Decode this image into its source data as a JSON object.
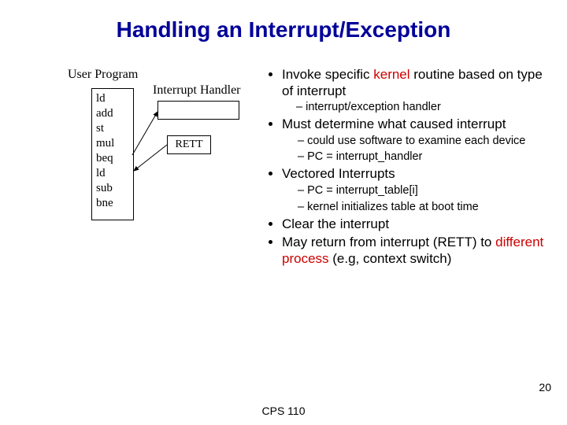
{
  "title": "Handling an Interrupt/Exception",
  "diagram": {
    "user_program_label": "User Program",
    "instructions": [
      "ld",
      "add",
      "st",
      "mul",
      "beq",
      "ld",
      "sub",
      "bne"
    ],
    "interrupt_handler_label": "Interrupt Handler",
    "rett_label": "RETT"
  },
  "bullets": {
    "b1_pre": "Invoke specific ",
    "b1_red": "kernel",
    "b1_post": " routine based on type of interrupt",
    "b1_sub1": "interrupt/exception handler",
    "b2": "Must determine what caused interrupt",
    "b2_sub1": "could use software to examine each device",
    "b2_sub2": "PC = interrupt_handler",
    "b3": "Vectored Interrupts",
    "b3_sub1": "PC = interrupt_table[i]",
    "b3_sub2": "kernel initializes table at boot time",
    "b4": "Clear the interrupt",
    "b5_pre": "May return from interrupt (RETT) to ",
    "b5_red": "different process",
    "b5_post": " (e.g, context switch)"
  },
  "footer": {
    "course": "CPS 110",
    "page": "20"
  }
}
